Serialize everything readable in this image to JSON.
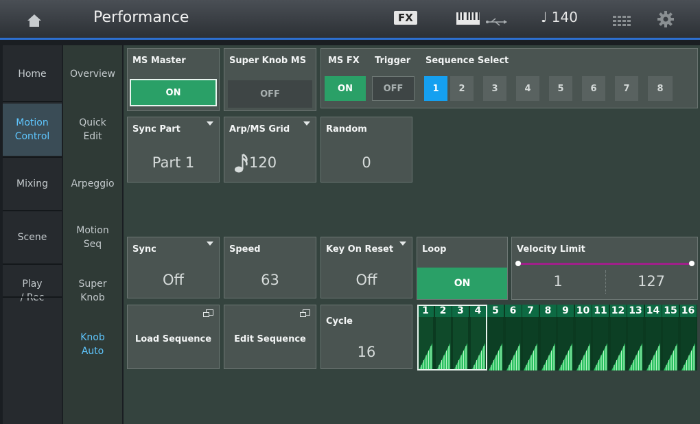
{
  "header": {
    "title": "Performance",
    "fx": "FX",
    "tempo": "♩ 140",
    "keyboard_icon": "keyboard-icon",
    "usb_icon": "usb-icon",
    "grid_icon": "grid-icon",
    "settings_icon": "gear-icon"
  },
  "nav_main": [
    "Home",
    "Motion\nControl",
    "Mixing",
    "Scene",
    "Play\n/ Rec"
  ],
  "nav_sub": [
    "Overview",
    "Quick\nEdit",
    "Arpeggio",
    "Motion\nSeq",
    "Super\nKnob",
    "Knob\nAuto"
  ],
  "ms_master": {
    "label": "MS Master",
    "value": "ON"
  },
  "super_knob_ms": {
    "label": "Super Knob MS",
    "value": "OFF"
  },
  "ms_fx": {
    "label": "MS FX",
    "value": "ON"
  },
  "trigger": {
    "label": "Trigger",
    "value": "OFF"
  },
  "sequence_select": {
    "label": "Sequence Select",
    "options": [
      "1",
      "2",
      "3",
      "4",
      "5",
      "6",
      "7",
      "8"
    ],
    "selected": "1"
  },
  "sync_part": {
    "label": "Sync Part",
    "value": "Part 1"
  },
  "arp_ms_grid": {
    "label": "Arp/MS Grid",
    "value": "120"
  },
  "random": {
    "label": "Random",
    "value": "0"
  },
  "sync": {
    "label": "Sync",
    "value": "Off"
  },
  "speed": {
    "label": "Speed",
    "value": "63"
  },
  "key_on_reset": {
    "label": "Key On Reset",
    "value": "Off"
  },
  "loop": {
    "label": "Loop",
    "value": "ON"
  },
  "velocity_limit": {
    "label": "Velocity Limit",
    "low": "1",
    "high": "127"
  },
  "load_sequence": {
    "label": "Load Sequence"
  },
  "edit_sequence": {
    "label": "Edit Sequence"
  },
  "cycle": {
    "label": "Cycle",
    "value": "16"
  },
  "steps": [
    "1",
    "2",
    "3",
    "4",
    "5",
    "6",
    "7",
    "8",
    "9",
    "10",
    "11",
    "12",
    "13",
    "14",
    "15",
    "16"
  ],
  "colors": {
    "accent": "#15a0f0",
    "on": "#2aa067",
    "panel": "#34433e"
  }
}
